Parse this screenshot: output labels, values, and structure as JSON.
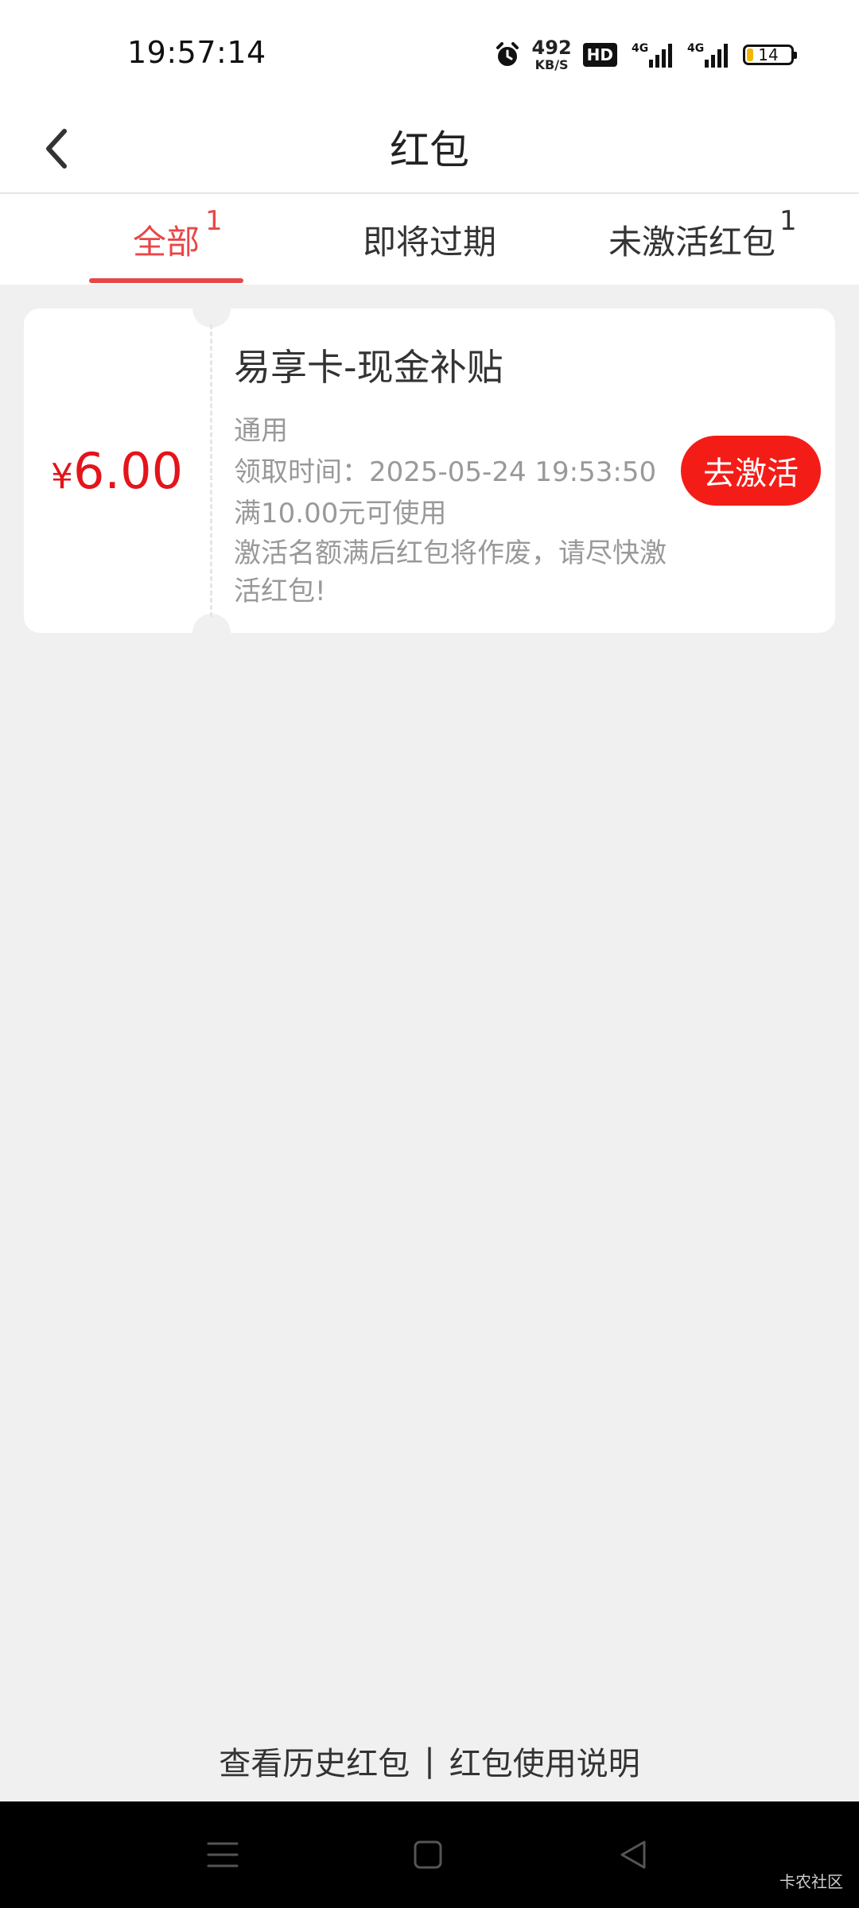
{
  "status_bar": {
    "time": "19:57:14",
    "net_speed_value": "492",
    "net_speed_unit": "KB/S",
    "hd_label": "HD",
    "sim1_label": "4G",
    "sim2_label": "4G",
    "battery_level": "14",
    "icons": [
      "alarm-icon",
      "hd-icon",
      "signal-4g-icon",
      "signal-4g-icon",
      "battery-icon"
    ]
  },
  "header": {
    "title": "红包"
  },
  "tabs": [
    {
      "label": "全部",
      "count": "1",
      "active": true
    },
    {
      "label": "即将过期",
      "count": "",
      "active": false
    },
    {
      "label": "未激活红包",
      "count": "1",
      "active": false
    }
  ],
  "coupon": {
    "currency": "¥",
    "amount": "6.00",
    "title": "易享卡-现金补贴",
    "scope": "通用",
    "received_time": "领取时间：2025-05-24 19:53:50",
    "condition": "满10.00元可使用",
    "note": "激活名额满后红包将作废，请尽快激活红包!",
    "button_label": "去激活"
  },
  "footer": {
    "history_link": "查看历史红包",
    "separator": "|",
    "instructions_link": "红包使用说明"
  },
  "watermark": "卡农社区",
  "colors": {
    "accent": "#e84747",
    "amount_red": "#e4141b",
    "button_red": "#f41c17",
    "background": "#f0f0f0"
  }
}
